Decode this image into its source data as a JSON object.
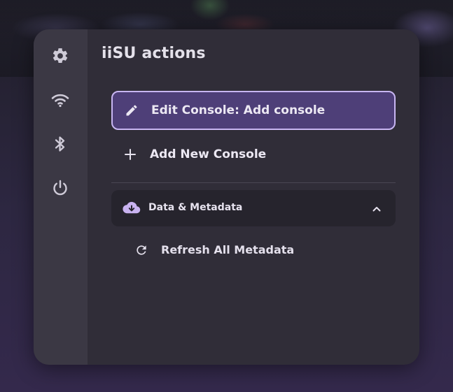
{
  "panel": {
    "title": "iiSU actions"
  },
  "sidebar": {
    "items": [
      {
        "icon": "gear-icon"
      },
      {
        "icon": "wifi-icon"
      },
      {
        "icon": "bluetooth-icon"
      },
      {
        "icon": "power-icon"
      }
    ]
  },
  "actions": [
    {
      "label": "Edit Console: Add console",
      "icon": "pencil-icon",
      "selected": true
    },
    {
      "label": "Add New Console",
      "icon": "plus-icon",
      "selected": false
    }
  ],
  "section": {
    "label": "Data & Metadata",
    "icon": "cloud-download-icon",
    "expanded": true,
    "items": [
      {
        "label": "Refresh All Metadata",
        "icon": "refresh-icon"
      }
    ]
  },
  "colors": {
    "panel_bg": "#302d38",
    "sidebar_bg": "#3b3844",
    "selected_bg": "#4e3f78",
    "selected_border": "#c8b6f2",
    "accent": "#c9b3f0"
  }
}
